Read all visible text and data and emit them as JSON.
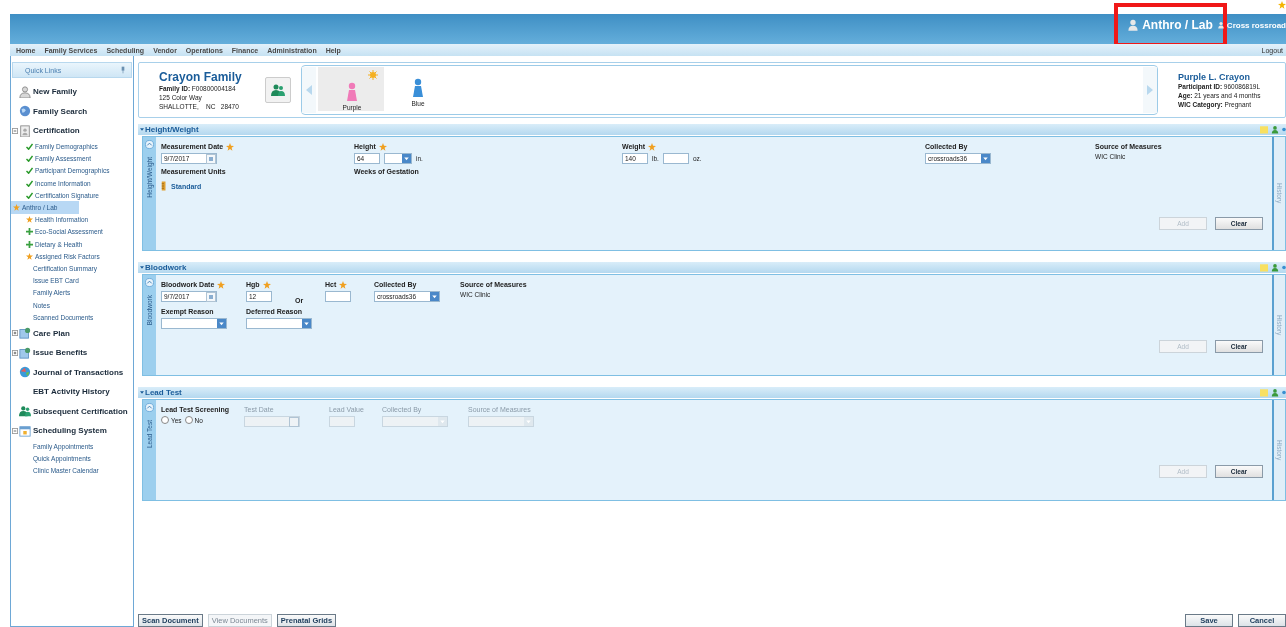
{
  "header": {
    "user_role": "Anthro / Lab",
    "user_name": "Cross rossroad",
    "highlighted": true,
    "logout": "Logout"
  },
  "menu": [
    "Home",
    "Family Services",
    "Scheduling",
    "Vendor",
    "Operations",
    "Finance",
    "Administration",
    "Help"
  ],
  "sidebar": {
    "title": "Quick Links",
    "items": [
      {
        "label": "New Family",
        "selected": false
      },
      {
        "label": "Family Search",
        "selected": false
      },
      {
        "label": "Certification",
        "selected": false,
        "expanded": true,
        "children": [
          {
            "label": "Family Demographics",
            "kind": "done",
            "selected": false
          },
          {
            "label": "Family Assessment",
            "kind": "done",
            "selected": false
          },
          {
            "label": "Participant Demographics",
            "kind": "done",
            "selected": false
          },
          {
            "label": "Income Information",
            "kind": "done",
            "selected": false
          },
          {
            "label": "Certification Signature",
            "kind": "done",
            "selected": false
          },
          {
            "label": "Anthro / Lab",
            "kind": "required",
            "selected": true
          },
          {
            "label": "Health Information",
            "kind": "required",
            "selected": false
          },
          {
            "label": "Eco-Social Assessment",
            "kind": "optional",
            "selected": false
          },
          {
            "label": "Dietary & Health",
            "kind": "optional",
            "selected": false
          },
          {
            "label": "Assigned Risk Factors",
            "kind": "required",
            "selected": false
          },
          {
            "label": "Certification Summary",
            "kind": "plain",
            "selected": false
          },
          {
            "label": "Issue EBT Card",
            "kind": "plain",
            "selected": false
          },
          {
            "label": "Family Alerts",
            "kind": "plain",
            "selected": false
          },
          {
            "label": "Notes",
            "kind": "plain",
            "selected": false
          },
          {
            "label": "Scanned Documents",
            "kind": "plain",
            "selected": false
          }
        ]
      },
      {
        "label": "Care Plan",
        "selected": false,
        "expanded": false
      },
      {
        "label": "Issue Benefits",
        "selected": false,
        "expanded": false
      },
      {
        "label": "Journal of Transactions",
        "selected": false
      },
      {
        "label": "EBT Activity History",
        "selected": false
      },
      {
        "label": "Subsequent Certification",
        "selected": false
      },
      {
        "label": "Scheduling System",
        "selected": false,
        "expanded": true,
        "children": [
          {
            "label": "Family Appointments",
            "kind": "plain",
            "selected": false
          },
          {
            "label": "Quick Appointments",
            "kind": "plain",
            "selected": false
          },
          {
            "label": "Clinic Master Calendar",
            "kind": "plain",
            "selected": false
          }
        ]
      }
    ]
  },
  "family": {
    "name": "Crayon Family",
    "id_label": "Family ID:",
    "id": "F00800004184",
    "address": "125 Color Way",
    "city": "SHALLOTTE,",
    "state": "NC",
    "zip": "28470"
  },
  "participants": [
    {
      "name": "Purple",
      "color": "#f07ab8",
      "selected": true,
      "alert": true
    },
    {
      "name": "Blue",
      "color": "#3a8fd8",
      "selected": false,
      "alert": false
    }
  ],
  "participant": {
    "name": "Purple L. Crayon",
    "details": [
      {
        "label": "Participant ID:",
        "value": "960086819L"
      },
      {
        "label": "Age:",
        "value": "21 years and 4 months"
      },
      {
        "label": "WIC Category:",
        "value": "Pregnant"
      }
    ]
  },
  "sections": [
    {
      "title": "Height/Weight",
      "side_label": "Height/Weight",
      "history": "History",
      "fields": [
        {
          "kind": "date",
          "label": "Measurement Date",
          "required": true,
          "disabled": false,
          "value": "9/7/2017"
        },
        {
          "kind": "measure",
          "label": "Height",
          "required": true,
          "disabled": false,
          "parts": [
            {
              "kind": "input",
              "value": "64"
            },
            {
              "kind": "select"
            },
            {
              "kind": "unit",
              "text": "in."
            }
          ]
        },
        {
          "kind": "measure",
          "label": "Weight",
          "required": true,
          "disabled": false,
          "parts": [
            {
              "kind": "input",
              "value": "140"
            },
            {
              "kind": "unit",
              "text": "lb."
            },
            {
              "kind": "input"
            },
            {
              "kind": "unit",
              "text": "oz."
            }
          ]
        },
        {
          "kind": "select",
          "label": "Collected By",
          "required": false,
          "disabled": false,
          "value": "crossroads36"
        },
        {
          "kind": "static",
          "label": "Source of Measures",
          "required": false,
          "disabled": false,
          "value": "WIC Clinic"
        },
        {
          "kind": "link",
          "label": "Measurement Units",
          "required": false,
          "disabled": false,
          "value": "Standard"
        },
        {
          "kind": "label",
          "label": "Weeks of Gestation",
          "required": false,
          "disabled": false
        }
      ],
      "buttons": [
        {
          "label": "Add",
          "disabled": true
        },
        {
          "label": "Clear",
          "disabled": false
        }
      ]
    },
    {
      "title": "Bloodwork",
      "side_label": "Bloodwork",
      "history": "History",
      "fields": [
        {
          "kind": "date",
          "label": "Bloodwork Date",
          "required": true,
          "disabled": false,
          "value": "9/7/2017"
        },
        {
          "kind": "measure",
          "label": "Hgb",
          "required": true,
          "disabled": false,
          "parts": [
            {
              "kind": "input",
              "value": "12"
            }
          ]
        },
        {
          "kind": "word",
          "text": "Or",
          "required": false,
          "disabled": false
        },
        {
          "kind": "measure",
          "label": "Hct",
          "required": true,
          "disabled": false,
          "parts": [
            {
              "kind": "input"
            }
          ]
        },
        {
          "kind": "select",
          "label": "Collected By",
          "required": false,
          "disabled": false,
          "value": "crossroads36"
        },
        {
          "kind": "static",
          "label": "Source of Measures",
          "required": false,
          "disabled": false,
          "value": "WIC Clinic"
        },
        {
          "kind": "select",
          "label": "Exempt Reason",
          "required": false,
          "disabled": false
        },
        {
          "kind": "select",
          "label": "Deferred Reason",
          "required": false,
          "disabled": false
        }
      ],
      "buttons": [
        {
          "label": "Add",
          "disabled": true
        },
        {
          "label": "Clear",
          "disabled": false
        }
      ]
    },
    {
      "title": "Lead Test",
      "side_label": "Lead Test",
      "history": "History",
      "fields": [
        {
          "kind": "radio",
          "label": "Lead Test Screening",
          "required": false,
          "disabled": false,
          "options": [
            {
              "label": "Yes",
              "selected": false
            },
            {
              "label": "No",
              "selected": false
            }
          ]
        },
        {
          "kind": "date",
          "label": "Test Date",
          "required": false,
          "disabled": true
        },
        {
          "kind": "measure",
          "label": "Lead Value",
          "required": false,
          "disabled": true,
          "parts": [
            {
              "kind": "input"
            }
          ]
        },
        {
          "kind": "select",
          "label": "Collected By",
          "required": false,
          "disabled": true
        },
        {
          "kind": "select",
          "label": "Source of Measures",
          "required": false,
          "disabled": true
        }
      ],
      "buttons": [
        {
          "label": "Add",
          "disabled": true
        },
        {
          "label": "Clear",
          "disabled": false
        }
      ]
    }
  ],
  "footer": {
    "left": [
      {
        "label": "Scan Document",
        "disabled": false
      },
      {
        "label": "View Documents",
        "disabled": true
      },
      {
        "label": "Prenatal Grids",
        "disabled": false
      }
    ],
    "right": [
      {
        "label": "Save",
        "disabled": false
      },
      {
        "label": "Cancel",
        "disabled": false
      }
    ]
  }
}
